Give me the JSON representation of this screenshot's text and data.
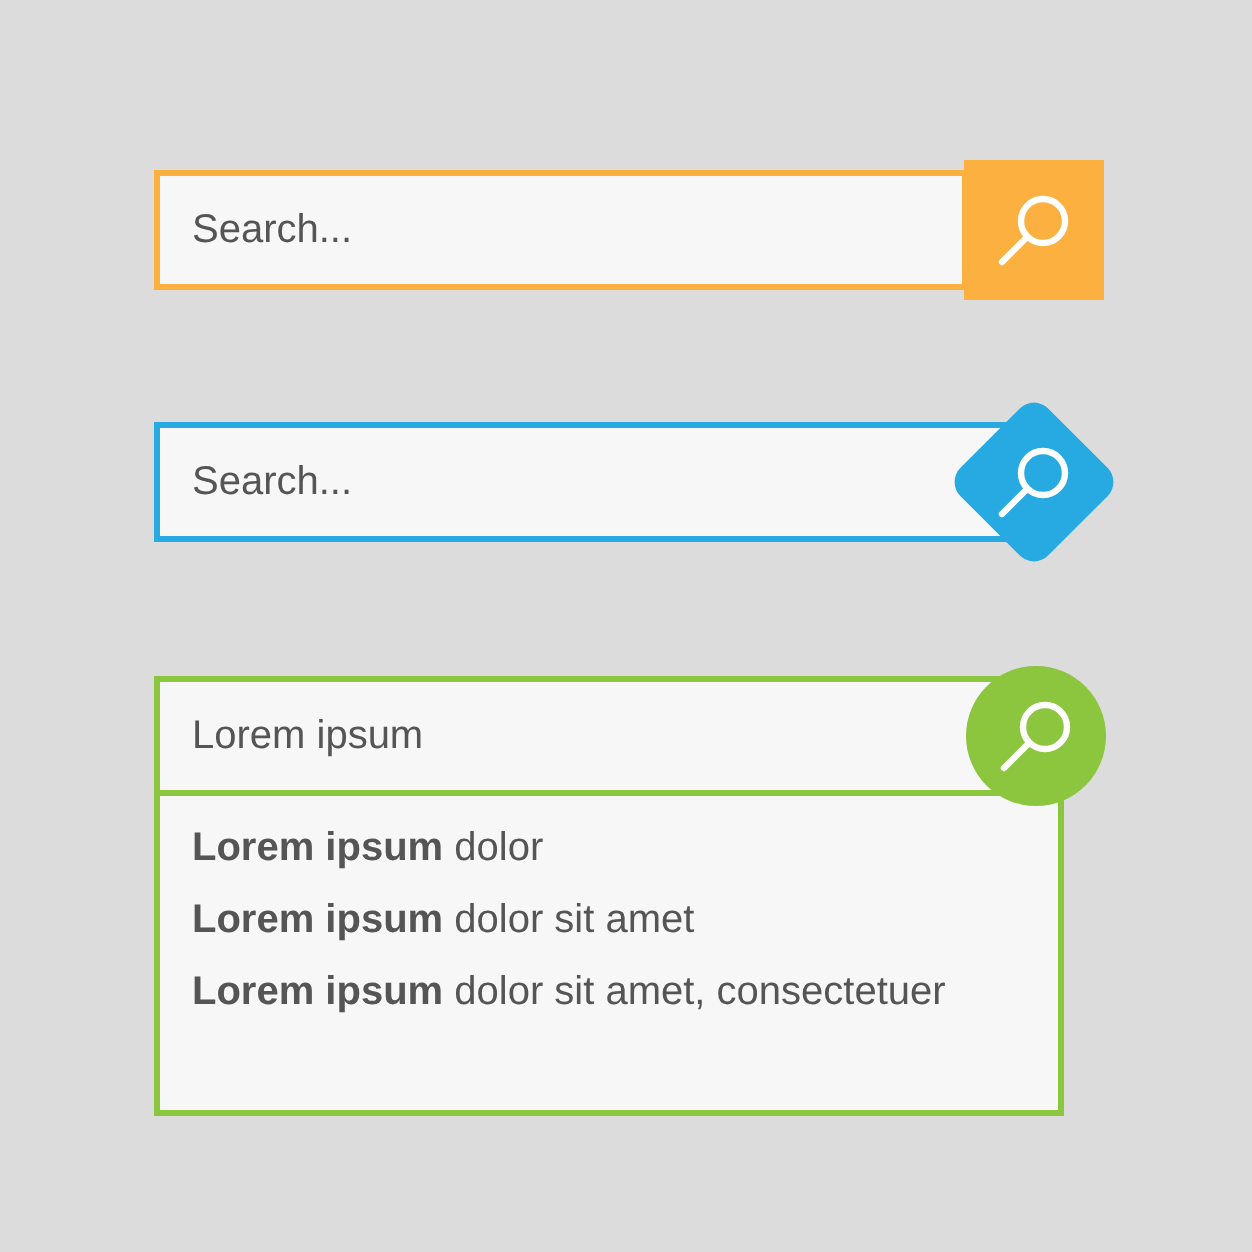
{
  "search_bars": [
    {
      "kind": "square",
      "color": "#fcb040",
      "placeholder": "Search..."
    },
    {
      "kind": "diamond",
      "color": "#27aae1",
      "placeholder": "Search..."
    },
    {
      "kind": "circle",
      "color": "#8cc63f",
      "value": "Lorem ipsum",
      "suggestions": [
        "**Lorem ipsum** dolor",
        "**Lorem ipsum** dolor sit amet",
        "**Lorem ipsum** dolor sit amet, consectetuer"
      ]
    }
  ]
}
